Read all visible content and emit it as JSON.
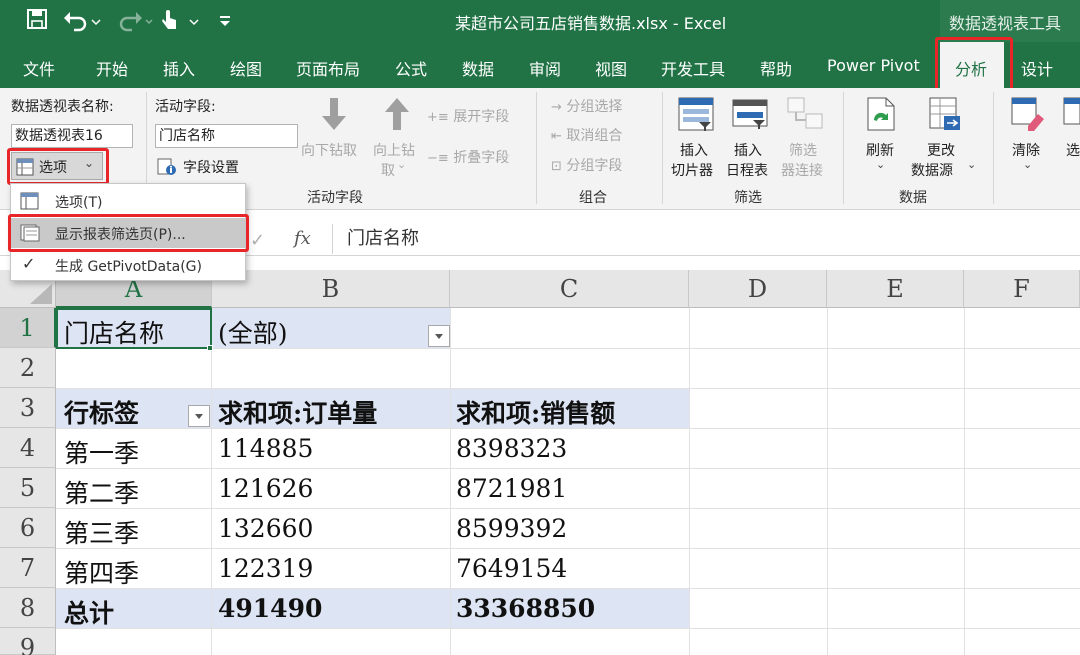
{
  "title_bar": {
    "file_title": "某超市公司五店销售数据.xlsx  -  Excel",
    "context_tool": "数据透视表工具"
  },
  "tabs": [
    "文件",
    "开始",
    "插入",
    "绘图",
    "页面布局",
    "公式",
    "数据",
    "审阅",
    "视图",
    "开发工具",
    "帮助",
    "Power Pivot",
    "分析",
    "设计"
  ],
  "active_tab": "分析",
  "ribbon": {
    "pivot_group": {
      "name_label": "数据透视表名称:",
      "name_value": "数据透视表16",
      "options_button": "选项"
    },
    "active_field": {
      "label": "活动字段:",
      "value": "门店名称",
      "settings": "字段设置",
      "drill_down": "向下钻取",
      "drill_up_line1": "向上钻",
      "drill_up_line2": "取",
      "expand": "展开字段",
      "collapse": "折叠字段",
      "group_label": "活动字段"
    },
    "group": {
      "group_selection": "分组选择",
      "ungroup": "取消组合",
      "group_field": "分组字段",
      "group_label": "组合"
    },
    "filter": {
      "slicer_line1": "插入",
      "slicer_line2": "切片器",
      "timeline_line1": "插入",
      "timeline_line2": "日程表",
      "conn_line1": "筛选",
      "conn_line2": "器连接",
      "group_label": "筛选"
    },
    "data": {
      "refresh": "刷新",
      "change_line1": "更改",
      "change_line2": "数据源",
      "group_label": "数据"
    },
    "actions": {
      "clear": "清除",
      "select": "选"
    }
  },
  "options_menu": [
    {
      "label": "选项(T)"
    },
    {
      "label": "显示报表筛选页(P)..."
    },
    {
      "label": "生成 GetPivotData(G)"
    }
  ],
  "formula_bar": {
    "fx": "fx",
    "value": "门店名称"
  },
  "columns": [
    "A",
    "B",
    "C",
    "D",
    "E",
    "F"
  ],
  "rows": [
    "1",
    "2",
    "3",
    "4",
    "5",
    "6",
    "7",
    "8",
    "9"
  ],
  "sheet": {
    "filter_field": "门店名称",
    "filter_value": "(全部)",
    "header": [
      "行标签",
      "求和项:订单量",
      "求和项:销售额"
    ],
    "data": [
      [
        "第一季",
        "114885",
        "8398323"
      ],
      [
        "第二季",
        "121626",
        "8721981"
      ],
      [
        "第三季",
        "132660",
        "8599392"
      ],
      [
        "第四季",
        "122319",
        "7649154"
      ]
    ],
    "total": [
      "总计",
      "491490",
      "33368850"
    ]
  }
}
